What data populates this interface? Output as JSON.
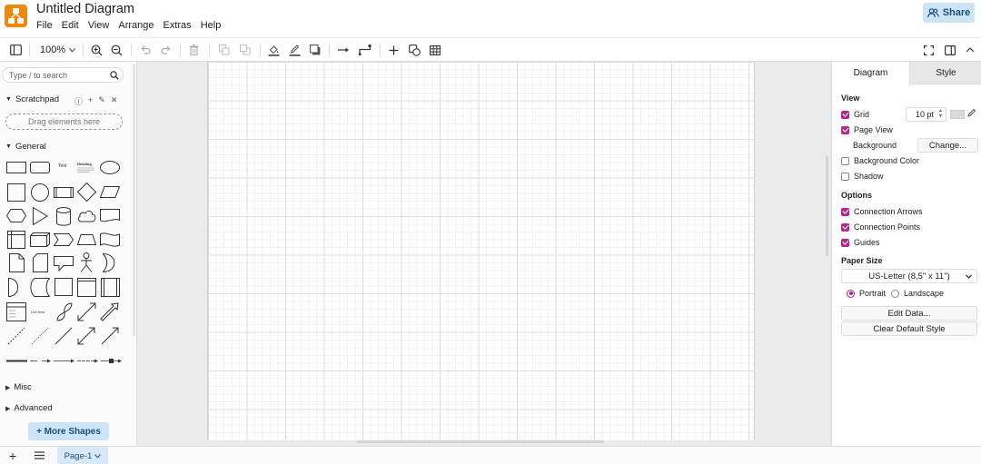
{
  "app": {
    "title": "Untitled Diagram"
  },
  "menu": [
    "File",
    "Edit",
    "View",
    "Arrange",
    "Extras",
    "Help"
  ],
  "share": {
    "label": "Share"
  },
  "toolbar": {
    "zoom": "100%"
  },
  "sidebar": {
    "search_placeholder": "Type / to search",
    "scratchpad": "Scratchpad",
    "drop_hint": "Drag elements here",
    "general": "General",
    "misc": "Misc",
    "advanced": "Advanced",
    "more_shapes": "+ More Shapes",
    "shape_text_label": "Text",
    "shape_heading_label": "Heading",
    "shape_list_label": "List Item"
  },
  "panel": {
    "tab_diagram": "Diagram",
    "tab_style": "Style",
    "view_title": "View",
    "grid": {
      "label": "Grid",
      "checked": true
    },
    "grid_size": "10 pt",
    "page_view": {
      "label": "Page View",
      "checked": true
    },
    "background_label": "Background",
    "change_btn": "Change...",
    "background_color": {
      "label": "Background Color",
      "checked": false
    },
    "shadow": {
      "label": "Shadow",
      "checked": false
    },
    "options_title": "Options",
    "connection_arrows": {
      "label": "Connection Arrows",
      "checked": true
    },
    "connection_points": {
      "label": "Connection Points",
      "checked": true
    },
    "guides": {
      "label": "Guides",
      "checked": true
    },
    "paper_size_title": "Paper Size",
    "paper_size_value": "US-Letter (8,5\" x 11\")",
    "portrait": {
      "label": "Portrait",
      "selected": true
    },
    "landscape": {
      "label": "Landscape",
      "selected": false
    },
    "edit_data": "Edit Data...",
    "clear_default_style": "Clear Default Style",
    "grid_color": "#d9d9d9",
    "accent_color": "#b5258a"
  },
  "footer": {
    "page_tab": "Page-1"
  }
}
